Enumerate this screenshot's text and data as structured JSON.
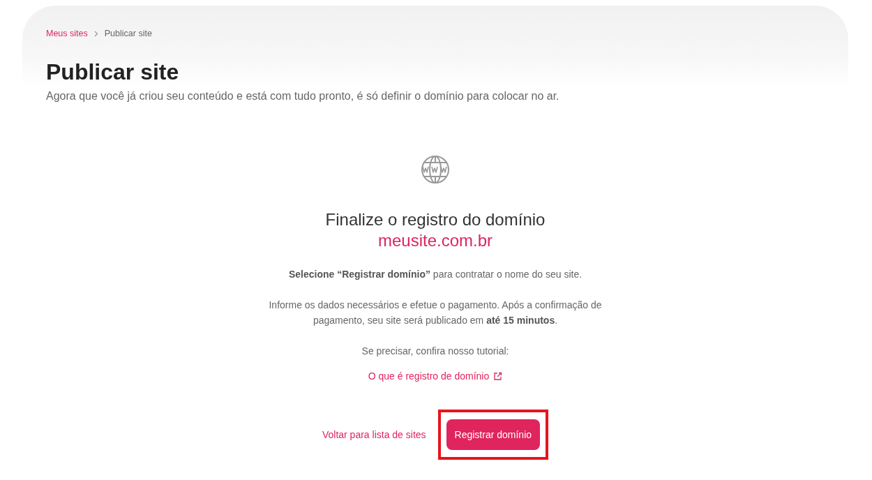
{
  "breadcrumb": [
    {
      "label": "Meus sites",
      "kind": "link"
    },
    {
      "label": "Publicar site",
      "kind": "current"
    }
  ],
  "title": "Publicar site",
  "subtitle": "Agora que você já criou seu conteúdo e está com tudo pronto, é só definir o domínio para colocar no ar.",
  "heading": "Finalize o registro do domínio",
  "domain": "meusite.com.br",
  "paragraphs": [
    "**Selecione “Registrar domínio”** para contratar o nome do seu site.",
    "Informe os dados necessários e efetue o pagamento. Após a confirmação de pagamento, seu site será publicado em **até 15 minutos**.",
    "Se precisar, confira nosso tutorial:"
  ],
  "tutorial_link": "O que é registro de domínio",
  "back_link": "Voltar para lista de sites",
  "primary_button": {
    "label": "Registrar domínio",
    "highlighted": true
  }
}
